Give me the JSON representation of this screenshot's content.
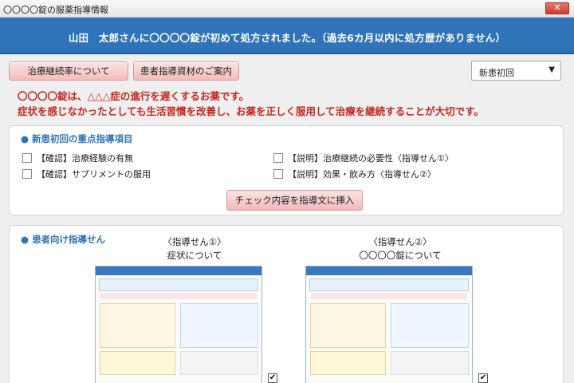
{
  "window": {
    "title": "〇〇〇〇錠の服薬指導情報",
    "close_label": "✕"
  },
  "banner": {
    "message": "山田　太郎さんに〇〇〇〇錠が初めて処方されました。（過去6カ月以内に処方歴がありません）"
  },
  "toolbar": {
    "rate_button": "治療継続率について",
    "material_button": "患者指導資材のご案内",
    "select_value": "新患初回",
    "select_arrow": "▼"
  },
  "notice": {
    "line1": "〇〇〇〇錠は、△△△症の進行を遅くするお薬です。",
    "line2": "症状を感じなかったとしても生活習慣を改善し、お薬を正しく服用して治療を継続することが大切です。"
  },
  "guidance": {
    "title": "新患初回の重点指導項目",
    "items": [
      {
        "label": "【確認】治療経験の有無",
        "checked": false
      },
      {
        "label": "【説明】治療継続の必要性〈指導せん①〉",
        "checked": false
      },
      {
        "label": "【確認】サプリメントの服用",
        "checked": false
      },
      {
        "label": "【説明】効果・飲み方〈指導せん②〉",
        "checked": false
      }
    ],
    "insert_button": "チェック内容を指導文に挿入"
  },
  "leaflets": {
    "title": "患者向け指導せん",
    "items": [
      {
        "heading": "〈指導せん①〉",
        "subheading": "症状について",
        "checked": true
      },
      {
        "heading": "〈指導せん②〉",
        "subheading": "〇〇〇〇錠について",
        "checked": true
      }
    ],
    "check_mark": "✔"
  },
  "colors": {
    "accent": "#2f73b8",
    "alert": "#c8261f",
    "button_pink": "#f4bcbc"
  }
}
